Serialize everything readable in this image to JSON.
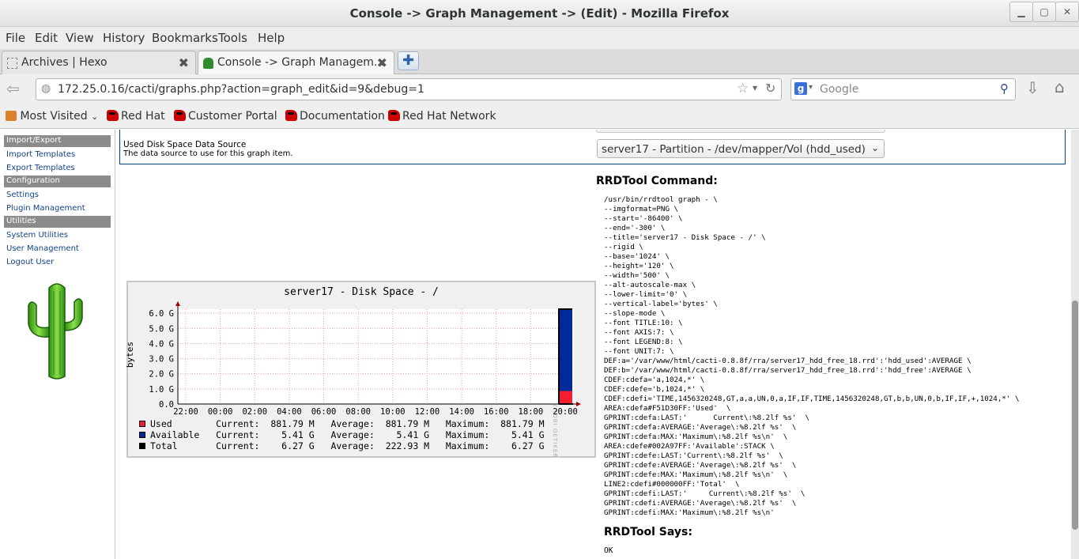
{
  "window": {
    "title": "Console -> Graph Management -> (Edit) - Mozilla Firefox"
  },
  "menu": [
    "File",
    "Edit",
    "View",
    "History",
    "Bookmarks",
    "Tools",
    "Help"
  ],
  "tabs": [
    {
      "label": "Archives | Hexo"
    },
    {
      "label": "Console -> Graph Managem..."
    }
  ],
  "nav": {
    "url": "172.25.0.16/cacti/graphs.php?action=graph_edit&id=9&debug=1",
    "search_placeholder": "Google"
  },
  "bookmarks": {
    "most_visited": "Most Visited",
    "items": [
      "Red Hat",
      "Customer Portal",
      "Documentation",
      "Red Hat Network"
    ]
  },
  "sidebar": {
    "sections": [
      {
        "head": "Import/Export",
        "links": [
          "Import Templates",
          "Export Templates"
        ]
      },
      {
        "head": "Configuration",
        "links": [
          "Settings",
          "Plugin Management"
        ]
      },
      {
        "head": "Utilities",
        "links": [
          "System Utilities",
          "User Management",
          "Logout User"
        ]
      }
    ]
  },
  "form": {
    "row_label": "Used Disk Space Data Source",
    "row_desc": "The data source to use for this graph item.",
    "row_value": "server17 - Partition - /dev/mapper/Vol (hdd_used)"
  },
  "graph": {
    "title": "server17 - Disk Space - /",
    "vertical_label": "bytes",
    "watermark": "RRDTOOL / TOBI OETIKER",
    "colors": {
      "used": "#F51D30",
      "available": "#002A97",
      "total": "#000000"
    }
  },
  "chart_data": {
    "type": "area",
    "title": "server17 - Disk Space - /",
    "ylabel": "bytes",
    "xlabel": "",
    "x_ticks": [
      "22:00",
      "00:00",
      "02:00",
      "04:00",
      "06:00",
      "08:00",
      "10:00",
      "12:00",
      "14:00",
      "16:00",
      "18:00",
      "20:00"
    ],
    "y_ticks": [
      "0.0",
      "1.0 G",
      "2.0 G",
      "3.0 G",
      "4.0 G",
      "5.0 G",
      "6.0 G"
    ],
    "ylim": [
      0,
      6.27
    ],
    "stacked": true,
    "series": [
      {
        "name": "Used",
        "color": "#F51D30",
        "current": "881.79 M",
        "average": "881.79 M",
        "maximum": "881.79 M"
      },
      {
        "name": "Available",
        "color": "#002A97",
        "current": "5.41 G",
        "average": "5.41 G",
        "maximum": "5.41 G"
      },
      {
        "name": "Total",
        "color": "#000000",
        "current": "6.27 G",
        "average": "222.93 M",
        "maximum": "6.27 G"
      }
    ],
    "legend_labels": {
      "current": "Current:",
      "average": "Average:",
      "maximum": "Maximum:"
    }
  },
  "rrdtool": {
    "command_title": "RRDTool Command:",
    "command_lines": [
      "/usr/bin/rrdtool graph - \\",
      "--imgformat=PNG \\",
      "--start='-86400' \\",
      "--end='-300' \\",
      "--title='server17 - Disk Space - /' \\",
      "--rigid \\",
      "--base='1024' \\",
      "--height='120' \\",
      "--width='500' \\",
      "--alt-autoscale-max \\",
      "--lower-limit='0' \\",
      "--vertical-label='bytes' \\",
      "--slope-mode \\",
      "--font TITLE:10: \\",
      "--font AXIS:7: \\",
      "--font LEGEND:8: \\",
      "--font UNIT:7: \\",
      "DEF:a='/var/www/html/cacti-0.8.8f/rra/server17_hdd_free_18.rrd':'hdd_used':AVERAGE \\",
      "DEF:b='/var/www/html/cacti-0.8.8f/rra/server17_hdd_free_18.rrd':'hdd_free':AVERAGE \\",
      "CDEF:cdefa='a,1024,*' \\",
      "CDEF:cdefe='b,1024,*' \\",
      "CDEF:cdefi='TIME,1456320248,GT,a,a,UN,0,a,IF,IF,TIME,1456320248,GT,b,b,UN,0,b,IF,IF,+,1024,*' \\",
      "AREA:cdefa#F51D30FF:'Used'  \\",
      "GPRINT:cdefa:LAST:'      Current\\:%8.2lf %s'  \\",
      "GPRINT:cdefa:AVERAGE:'Average\\:%8.2lf %s'  \\",
      "GPRINT:cdefa:MAX:'Maximum\\:%8.2lf %s\\n'  \\",
      "AREA:cdefe#002A97FF:'Available':STACK \\",
      "GPRINT:cdefe:LAST:'Current\\:%8.2lf %s'  \\",
      "GPRINT:cdefe:AVERAGE:'Average\\:%8.2lf %s'  \\",
      "GPRINT:cdefe:MAX:'Maximum\\:%8.2lf %s\\n'  \\",
      "LINE2:cdefi#000000FF:'Total'  \\",
      "GPRINT:cdefi:LAST:'     Current\\:%8.2lf %s'  \\",
      "GPRINT:cdefi:AVERAGE:'Average\\:%8.2lf %s'  \\",
      "GPRINT:cdefi:MAX:'Maximum\\:%8.2lf %s\\n'"
    ],
    "says_title": "RRDTool Says:",
    "says_output": "OK"
  }
}
